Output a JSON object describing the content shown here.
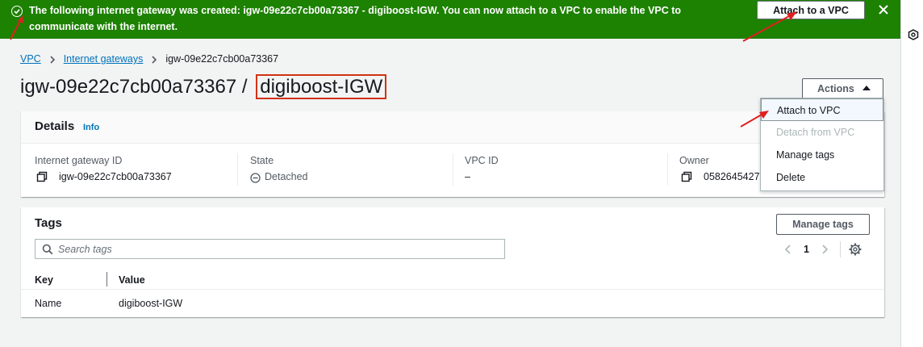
{
  "banner": {
    "message": "The following internet gateway was created: igw-09e22c7cb00a73367 - digiboost-IGW. You can now attach to a VPC to enable the VPC to communicate with the internet.",
    "action_label": "Attach to a VPC",
    "status_color": "#1d8102"
  },
  "breadcrumb": {
    "items": [
      "VPC",
      "Internet gateways"
    ],
    "current": "igw-09e22c7cb00a73367"
  },
  "page": {
    "title_id": "igw-09e22c7cb00a73367",
    "title_separator": " / ",
    "title_name": "digiboost-IGW"
  },
  "actions": {
    "label": "Actions",
    "menu": [
      {
        "label": "Attach to VPC",
        "enabled": true
      },
      {
        "label": "Detach from VPC",
        "enabled": false
      },
      {
        "label": "Manage tags",
        "enabled": true
      },
      {
        "label": "Delete",
        "enabled": true
      }
    ]
  },
  "details": {
    "title": "Details",
    "info_label": "Info",
    "fields": [
      {
        "label": "Internet gateway ID",
        "value": "igw-09e22c7cb00a73367",
        "icon": "copy-icon"
      },
      {
        "label": "State",
        "value": "Detached",
        "icon": "detached-icon"
      },
      {
        "label": "VPC ID",
        "value": "–"
      },
      {
        "label": "Owner",
        "value": "0582645427",
        "icon": "copy-icon"
      }
    ]
  },
  "tags": {
    "title": "Tags",
    "manage_label": "Manage tags",
    "search_placeholder": "Search tags",
    "page_number": "1",
    "columns": [
      "Key",
      "Value"
    ],
    "rows": [
      {
        "key": "Name",
        "value": "digiboost-IGW"
      }
    ]
  },
  "annotation_color": "#e02020"
}
